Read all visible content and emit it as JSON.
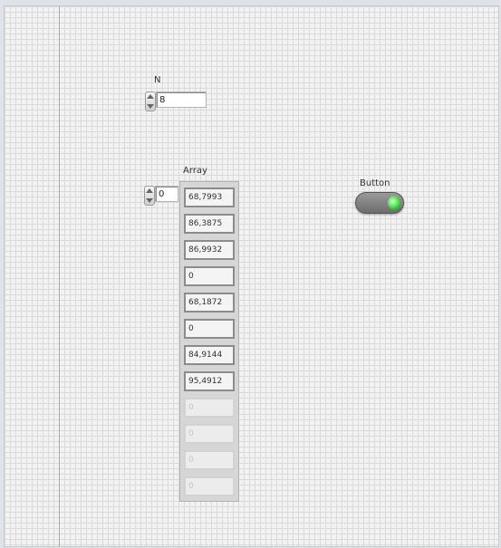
{
  "n_control": {
    "label": "N",
    "value": "8"
  },
  "array": {
    "label": "Array",
    "index": "0",
    "items": [
      "68,7993",
      "86,3875",
      "86,9932",
      "0",
      "68,1872",
      "0",
      "84,9144",
      "95,4912"
    ],
    "empty_items": [
      "0",
      "0",
      "0",
      "0"
    ]
  },
  "button": {
    "label": "Button",
    "state": "on",
    "led_color": "#33d13a"
  }
}
